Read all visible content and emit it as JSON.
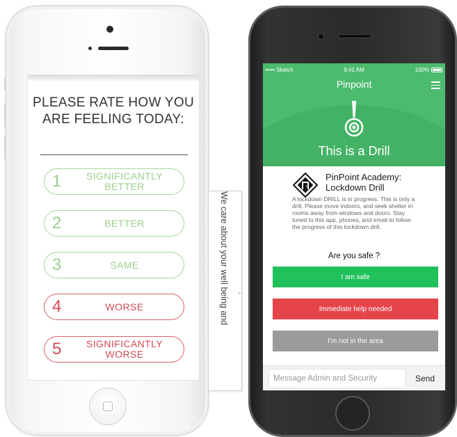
{
  "rating_screen": {
    "title": "PLEASE RATE HOW YOU ARE FEELING TODAY:",
    "options": [
      {
        "number": "1",
        "label": "SIGNIFICANTLY BETTER"
      },
      {
        "number": "2",
        "label": "BETTER"
      },
      {
        "number": "3",
        "label": "SAME"
      },
      {
        "number": "4",
        "label": "WORSE"
      },
      {
        "number": "5",
        "label": "SIGNIFICANTLY WORSE"
      }
    ],
    "colors": {
      "positive": "#9cd08c",
      "negative": "#d24a56"
    }
  },
  "side_card": {
    "text": "We care about your well being and",
    "ellipsis": "..."
  },
  "pinpoint_screen": {
    "status_bar": {
      "carrier": "••••• Sketch",
      "time": "9:41 AM",
      "battery": "100%"
    },
    "app_title": "Pinpoint",
    "banner_title": "This is a Drill",
    "org_name": "PinPoint Academy: Lockdown Drill",
    "message": "A lockdown DRILL is in progress. This is only a drill. Please move indoors, and seek shelter in rooms away from windows and doors. Stay tuned to this app, phones, and email to follow the progress of this lockdown drill.",
    "question": "Are you safe ?",
    "buttons": {
      "safe": "I am safe",
      "help": "Immediate help needed",
      "away": "I'm not in the area"
    },
    "composer": {
      "placeholder": "Message Admin and Security",
      "send": "Send"
    },
    "colors": {
      "brand_green": "#4dbb6e",
      "safe": "#21c15c",
      "help": "#e5454a",
      "away": "#9b9b9b"
    },
    "icons": {
      "menu": "hamburger-menu-icon",
      "alert": "pin-alert-icon",
      "logo": "lockdown-door-icon"
    }
  }
}
